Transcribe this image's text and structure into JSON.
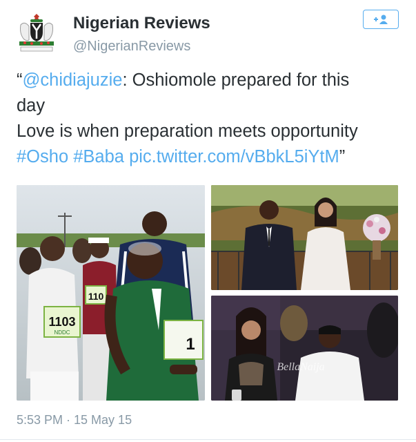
{
  "account": {
    "name": "Nigerian Reviews",
    "handle": "@NigerianReviews"
  },
  "follow_button": {
    "icon": "add-user-icon",
    "color": "#55acee"
  },
  "tweet": {
    "line1": {
      "open_quote": "“",
      "mention": "@chidiajuzie",
      "text": ": Oshiomole prepared for this"
    },
    "line2": "day",
    "line3": "Love is when preparation meets opportunity",
    "line4": {
      "hashtag1": "#Osho",
      "hashtag2": "#Baba",
      "link": "pic.twitter.com/vBbkL5iYtM",
      "close_quote": "”"
    }
  },
  "photos": {
    "runner_bib_1": "1103",
    "runner_bib_1_sponsor": "NDDC",
    "runner_bib_2": "110",
    "runner_bib_3": "1",
    "watermark": "BellaNaija"
  },
  "timestamp": "5:53 PM · 15 May 15",
  "colors": {
    "link": "#55acee",
    "text": "#292f33",
    "muted": "#8899a6"
  }
}
